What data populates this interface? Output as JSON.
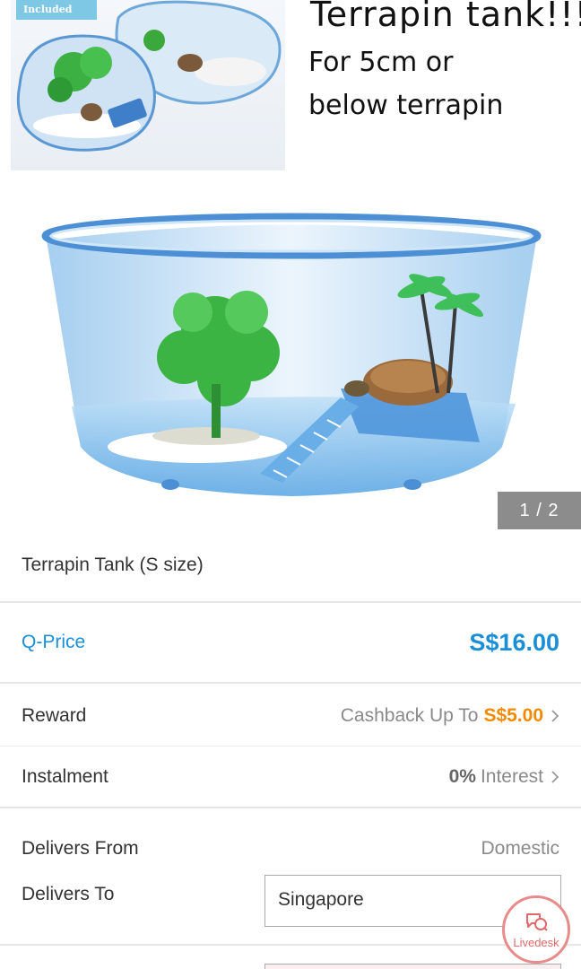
{
  "gallery": {
    "inset_badge": "Included",
    "promo_title": "Terrapin tank!!!",
    "promo_line2": "For 5cm or",
    "promo_line3": "below terrapin",
    "counter": "1 / 2"
  },
  "product": {
    "title": "Terrapin Tank (S size)"
  },
  "price": {
    "label": "Q-Price",
    "value": "S$16.00"
  },
  "reward": {
    "label": "Reward",
    "text": "Cashback Up To",
    "amount": "S$5.00"
  },
  "instalment": {
    "label": "Instalment",
    "rate": "0%",
    "text": "Interest"
  },
  "delivery": {
    "from_label": "Delivers From",
    "from_value": "Domestic",
    "to_label": "Delivers To",
    "to_value": "Singapore"
  },
  "livedesk": {
    "label": "Livedesk"
  },
  "colors": {
    "accent_blue": "#1a8fd6",
    "accent_orange": "#f08b00",
    "livedesk_red": "#e06a6a"
  }
}
